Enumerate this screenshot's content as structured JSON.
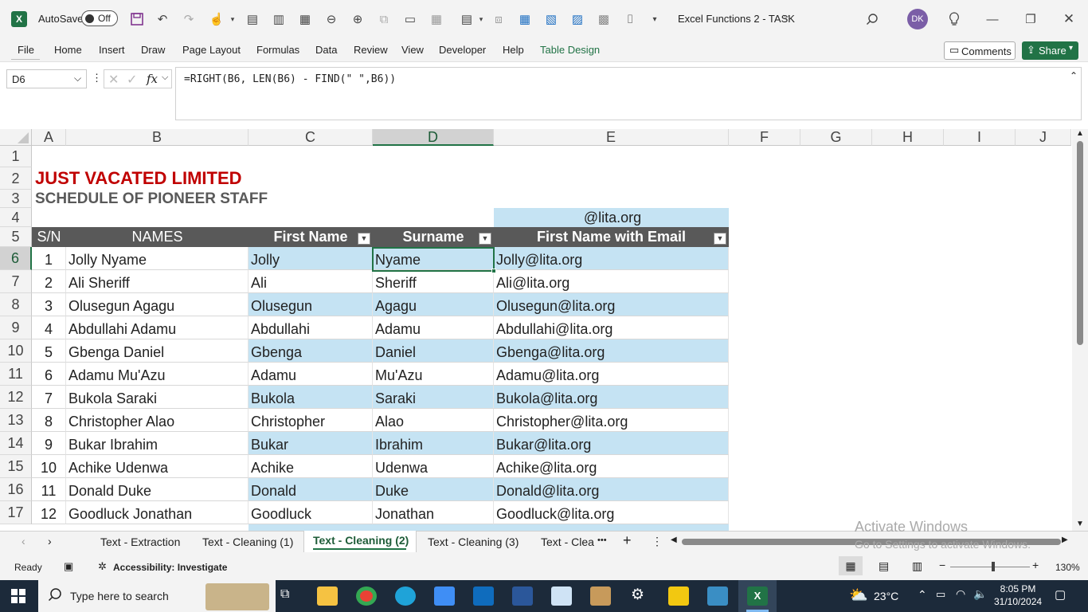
{
  "titlebar": {
    "autosave_label": "AutoSave",
    "autosave_state": "Off",
    "doc_title": "Excel Functions 2 - TASK",
    "user_initials": "DK"
  },
  "ribbon": {
    "tabs": [
      "File",
      "Home",
      "Insert",
      "Draw",
      "Page Layout",
      "Formulas",
      "Data",
      "Review",
      "View",
      "Developer",
      "Help",
      "Table Design"
    ],
    "comments_label": "Comments",
    "share_label": "Share"
  },
  "formula_bar": {
    "name_box": "D6",
    "fx": "fx",
    "formula": "=RIGHT(B6, LEN(B6) - FIND(\" \",B6))"
  },
  "grid": {
    "columns": [
      "A",
      "B",
      "C",
      "D",
      "E",
      "F",
      "G",
      "H",
      "I",
      "J"
    ],
    "rows": [
      "1",
      "2",
      "3",
      "4",
      "5",
      "6",
      "7",
      "8",
      "9",
      "10",
      "11",
      "12",
      "13",
      "14",
      "15",
      "16",
      "17"
    ],
    "title": "JUST VACATED LIMITED",
    "subtitle": "SCHEDULE OF PIONEER STAFF",
    "email_suffix": "@lita.org",
    "headers": [
      "S/N",
      "NAMES",
      "First Name",
      "Surname",
      "First Name with Email"
    ],
    "data_rows": [
      [
        "1",
        "Jolly Nyame",
        "Jolly",
        "Nyame",
        "Jolly@lita.org"
      ],
      [
        "2",
        "Ali Sheriff",
        "Ali",
        "Sheriff",
        "Ali@lita.org"
      ],
      [
        "3",
        "Olusegun Agagu",
        "Olusegun",
        "Agagu",
        "Olusegun@lita.org"
      ],
      [
        "4",
        "Abdullahi Adamu",
        "Abdullahi",
        "Adamu",
        "Abdullahi@lita.org"
      ],
      [
        "5",
        "Gbenga Daniel",
        "Gbenga",
        "Daniel",
        "Gbenga@lita.org"
      ],
      [
        "6",
        "Adamu Mu'Azu",
        "Adamu",
        "Mu'Azu",
        "Adamu@lita.org"
      ],
      [
        "7",
        "Bukola Saraki",
        "Bukola",
        "Saraki",
        "Bukola@lita.org"
      ],
      [
        "8",
        "Christopher Alao",
        "Christopher",
        "Alao",
        "Christopher@lita.org"
      ],
      [
        "9",
        "Bukar Ibrahim",
        "Bukar",
        "Ibrahim",
        "Bukar@lita.org"
      ],
      [
        "10",
        "Achike Udenwa",
        "Achike",
        "Udenwa",
        "Achike@lita.org"
      ],
      [
        "11",
        "Donald Duke",
        "Donald",
        "Duke",
        "Donald@lita.org"
      ],
      [
        "12",
        "Goodluck Jonathan",
        "Goodluck",
        "Jonathan",
        "Goodluck@lita.org"
      ]
    ],
    "active_cell": "D6"
  },
  "sheet_tabs": {
    "tabs": [
      "Text - Extraction",
      "Text - Cleaning (1)",
      "Text - Cleaning (2)",
      "Text - Cleaning (3)",
      "Text - Clea"
    ],
    "active_index": 2,
    "more": "•••",
    "add": "+"
  },
  "watermark": {
    "line1": "Activate Windows",
    "line2": "Go to Settings to activate Windows."
  },
  "status": {
    "ready": "Ready",
    "accessibility": "Accessibility: Investigate",
    "zoom": "130%"
  },
  "taskbar": {
    "search_placeholder": "Type here to search",
    "temperature": "23°C",
    "time": "8:05 PM",
    "date": "31/10/2024"
  },
  "colors": {
    "excel_green": "#217346",
    "title_red": "#c00000",
    "header_gray": "#595959",
    "band_blue": "#c5e3f3"
  }
}
